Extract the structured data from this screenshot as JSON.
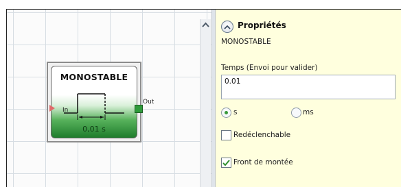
{
  "block": {
    "title": "MONOSTABLE",
    "value": "0,01 s",
    "input_label": "In",
    "output_label": "Out"
  },
  "properties": {
    "title": "Propriétés",
    "block_name": "MONOSTABLE",
    "time_field": {
      "label": "Temps (Envoi pour valider)",
      "value": "0.01"
    },
    "unit_options": [
      {
        "label": "s",
        "selected": true
      },
      {
        "label": "ms",
        "selected": false
      }
    ],
    "checkboxes": [
      {
        "label": "Redéclenchable",
        "checked": false
      },
      {
        "label": "Front de montée",
        "checked": true
      }
    ]
  },
  "icons": {
    "scroll_up": "chevron-up-icon",
    "collapse": "collapse-up-icon",
    "check": "check-icon"
  },
  "colors": {
    "panel_background": "#ffffde",
    "block_green": "#2e9b3a",
    "input_port": "#e06a6a"
  }
}
